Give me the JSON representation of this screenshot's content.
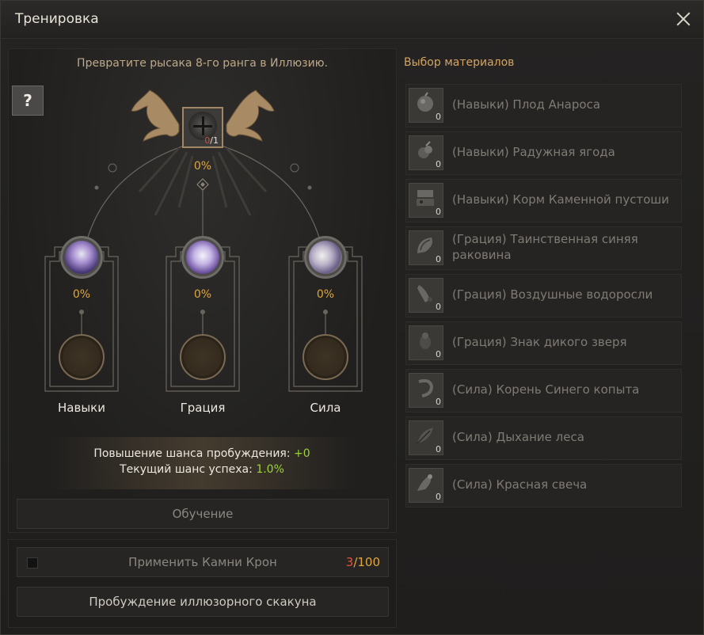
{
  "window": {
    "title": "Тренировка"
  },
  "left": {
    "instruction": "Превратите рысака 8-го ранга в Иллюзию.",
    "help_label": "?",
    "center_slot": {
      "current": "0",
      "required": "/1",
      "chance": "0%"
    },
    "columns": [
      {
        "label": "Навыки",
        "chance": "0%"
      },
      {
        "label": "Грация",
        "chance": "0%"
      },
      {
        "label": "Сила",
        "chance": "0%"
      }
    ],
    "awaken_bonus_label": "Повышение шанса пробуждения:",
    "awaken_bonus_value": "+0",
    "success_label": "Текущий шанс успеха:",
    "success_value": "1.0%",
    "train_button": "Обучение"
  },
  "bottom": {
    "stones_label": "Применить Камни Крон",
    "stones_current": "3",
    "stones_max": "/100",
    "awaken_button": "Пробуждение иллюзорного скакуна"
  },
  "materials": {
    "title": "Выбор материалов",
    "items": [
      {
        "name": "(Навыки) Плод Анароса",
        "qty": "0",
        "icon": "fruit-icon"
      },
      {
        "name": "(Навыки) Радужная ягода",
        "qty": "0",
        "icon": "berry-icon"
      },
      {
        "name": "(Навыки) Корм Каменной пустоши",
        "qty": "0",
        "icon": "feed-icon"
      },
      {
        "name": "(Грация) Таинственная синяя раковина",
        "qty": "0",
        "icon": "shell-icon"
      },
      {
        "name": "(Грация) Воздушные водоросли",
        "qty": "0",
        "icon": "seaweed-icon"
      },
      {
        "name": "(Грация) Знак дикого зверя",
        "qty": "0",
        "icon": "beast-mark-icon"
      },
      {
        "name": "(Сила) Корень Синего копыта",
        "qty": "0",
        "icon": "root-icon"
      },
      {
        "name": "(Сила) Дыхание леса",
        "qty": "0",
        "icon": "leaf-icon"
      },
      {
        "name": "(Сила) Красная свеча",
        "qty": "0",
        "icon": "candle-icon"
      }
    ]
  },
  "colors": {
    "accent_gold": "#e0a63a",
    "bonus_green": "#9bd338",
    "warning_red": "#e0523f"
  }
}
